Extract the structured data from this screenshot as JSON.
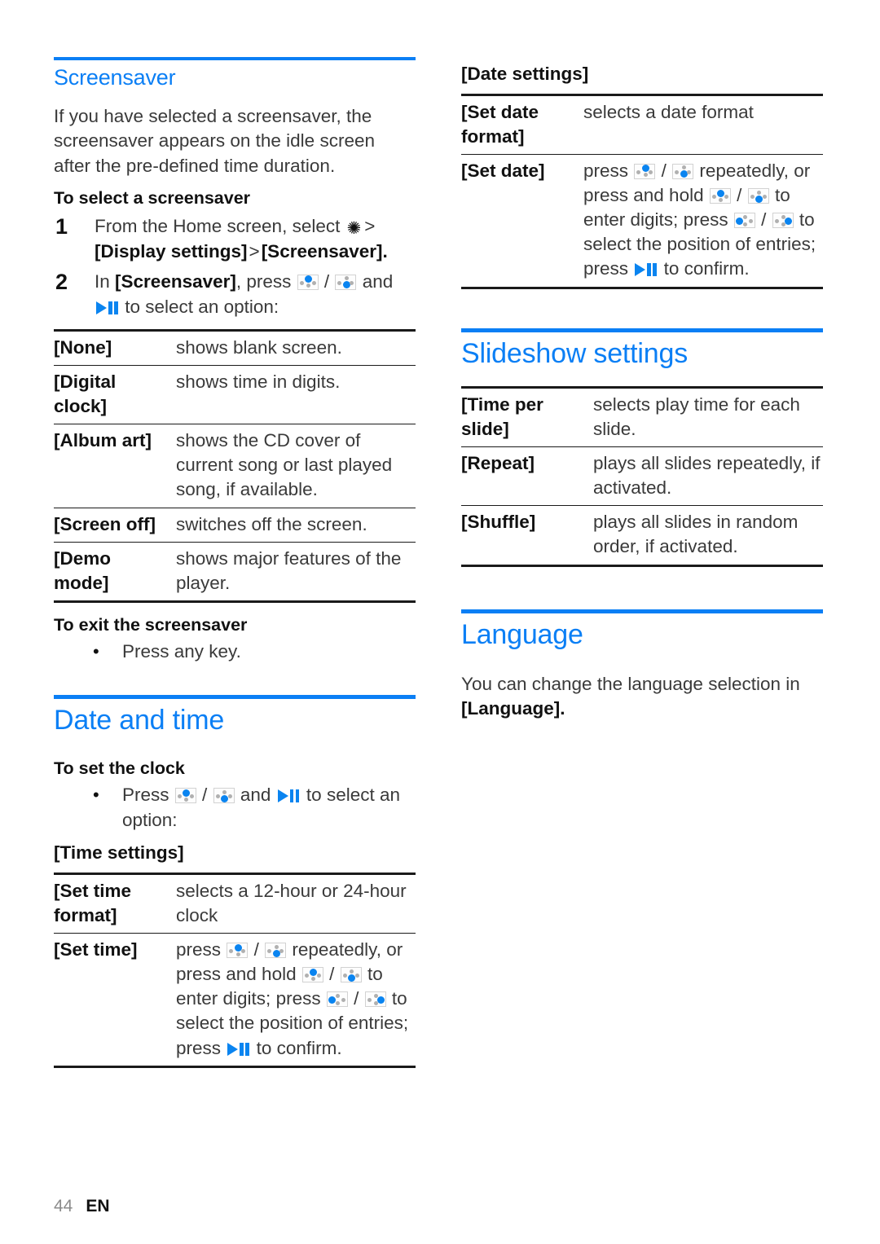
{
  "page": {
    "number": "44",
    "language_code": "EN"
  },
  "icons": {
    "gear": "gear-icon",
    "nav_up": "nav-up-icon",
    "nav_down": "nav-down-icon",
    "nav_left": "nav-left-icon",
    "nav_right": "nav-right-icon",
    "play_pause": "play-pause-icon"
  },
  "colors": {
    "heading_blue": "#0b7ff5",
    "icon_blue": "#0a84f0",
    "rule_black": "#1a1a1a",
    "body_gray": "#3a3a3a"
  },
  "left_column": {
    "screensaver": {
      "title": "Screensaver",
      "intro": "If you have selected a screensaver, the screensaver appears on the idle screen after the pre-defined time duration.",
      "select_heading": "To select a screensaver",
      "step1": {
        "number": "1",
        "text_before_gear": "From the Home screen, select ",
        "gt1": ">",
        "bracket1": "[Display settings]",
        "gt2": ">",
        "bracket2": "[Screensaver]",
        "text_end": "."
      },
      "step2": {
        "number": "2",
        "text_start": "In ",
        "bracket": "[Screensaver]",
        "text_press": ", press ",
        "slash": "/",
        "text_and": "and",
        "text_end": "to select an option:"
      },
      "options_table": [
        {
          "key": "[None]",
          "desc": "shows blank screen."
        },
        {
          "key": "[Digital clock]",
          "desc": "shows time in digits."
        },
        {
          "key": "[Album art]",
          "desc": "shows the CD cover of current song or last played song, if available."
        },
        {
          "key": "[Screen off]",
          "desc": "switches off the screen."
        },
        {
          "key": "[Demo mode]",
          "desc": "shows major features of the player."
        }
      ],
      "exit_heading": "To exit the screensaver",
      "exit_bullet": "Press any key."
    },
    "date_and_time": {
      "title": "Date and time",
      "set_clock_heading": "To set the clock",
      "set_clock_bullet": {
        "text_press": "Press",
        "slash": "/",
        "text_and": "and",
        "text_end": "to select an option:"
      },
      "time_settings_label": "[Time settings]",
      "time_table": [
        {
          "key": "[Set time format]",
          "desc": "selects a 12-hour or 24-hour clock"
        }
      ],
      "set_time": {
        "key": "[Set time]",
        "p1": "press",
        "slash": "/",
        "p2": "repeatedly, or press and hold",
        "p3": "to enter digits; press",
        "p4": "to select the position of entries; press",
        "p5": "to confirm."
      }
    }
  },
  "right_column": {
    "date_settings_label": "[Date settings]",
    "date_table": [
      {
        "key": "[Set date format]",
        "desc": "selects a date format"
      }
    ],
    "set_date": {
      "key": "[Set date]",
      "p1": "press",
      "slash": "/",
      "p2": "repeatedly, or press and hold",
      "p3": "to enter digits; press",
      "p4": "to select the position of entries; press",
      "p5": "to confirm."
    },
    "slideshow_settings": {
      "title": "Slideshow settings",
      "table": [
        {
          "key": "[Time per slide]",
          "desc": "selects play time for each slide."
        },
        {
          "key": "[Repeat]",
          "desc": "plays all slides repeatedly, if activated."
        },
        {
          "key": "[Shuffle]",
          "desc": "plays all slides in random order, if activated."
        }
      ]
    },
    "language": {
      "title": "Language",
      "text_before": "You can change the language selection in ",
      "bracket": "[Language]",
      "text_after": "."
    }
  }
}
